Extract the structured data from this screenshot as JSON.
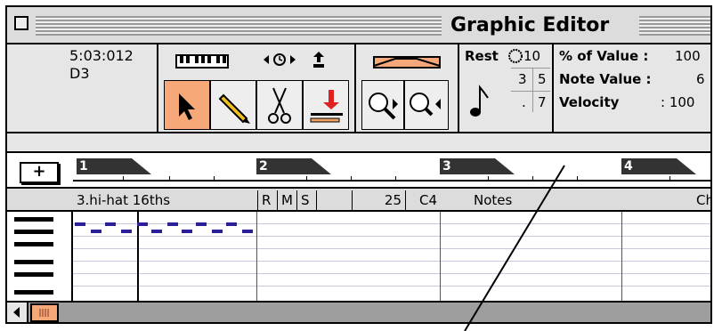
{
  "window": {
    "title": "Graphic Editor"
  },
  "info": {
    "position": "5:03:012",
    "pitch": "D3"
  },
  "params": {
    "rest_label": "Rest",
    "digits": [
      "10",
      "3",
      "5",
      ".",
      "7"
    ],
    "pct_label": "% of Value :",
    "pct_value": "100",
    "note_value_label": "Note Value :",
    "note_value": "6",
    "velocity_label": "Velocity",
    "velocity_value": ": 100"
  },
  "ruler": {
    "add_label": "+",
    "bars": [
      "1",
      "2",
      "3",
      "4"
    ]
  },
  "track": {
    "name": "3.hi-hat 16ths",
    "r": "R",
    "m": "M",
    "s": "S",
    "number": "25",
    "note": "C4",
    "mode": "Notes",
    "channel": "Ch"
  },
  "colors": {
    "accent": "#f6a878",
    "notes": "#2a1f96",
    "bar_flag": "#333333"
  }
}
